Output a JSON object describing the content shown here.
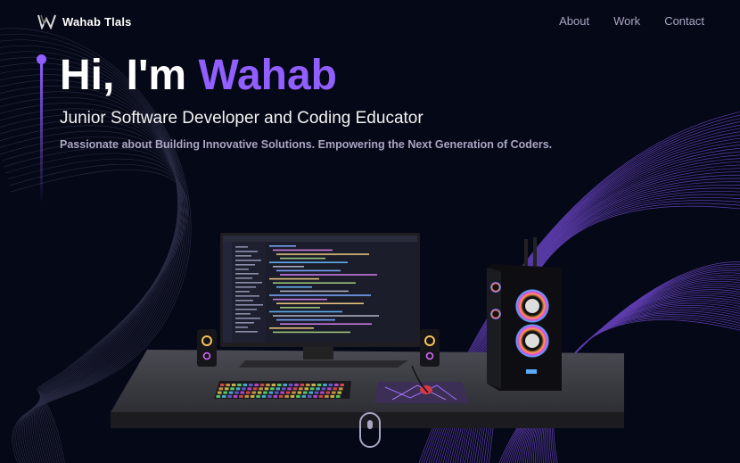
{
  "brand": {
    "name": "Wahab Tlals",
    "logo_icon": "w-logo-icon"
  },
  "nav": {
    "links": [
      "About",
      "Work",
      "Contact"
    ]
  },
  "hero": {
    "greeting": "Hi, I'm ",
    "name": "Wahab",
    "subtitle": "Junior Software Developer and Coding Educator",
    "tagline": "Passionate about Building Innovative Solutions. Empowering the Next Generation of Coders."
  },
  "colors": {
    "background": "#050816",
    "accent": "#915eff",
    "secondary_text": "#aaa6c3"
  },
  "scroll_indicator": {
    "icon": "mouse-scroll-icon"
  }
}
